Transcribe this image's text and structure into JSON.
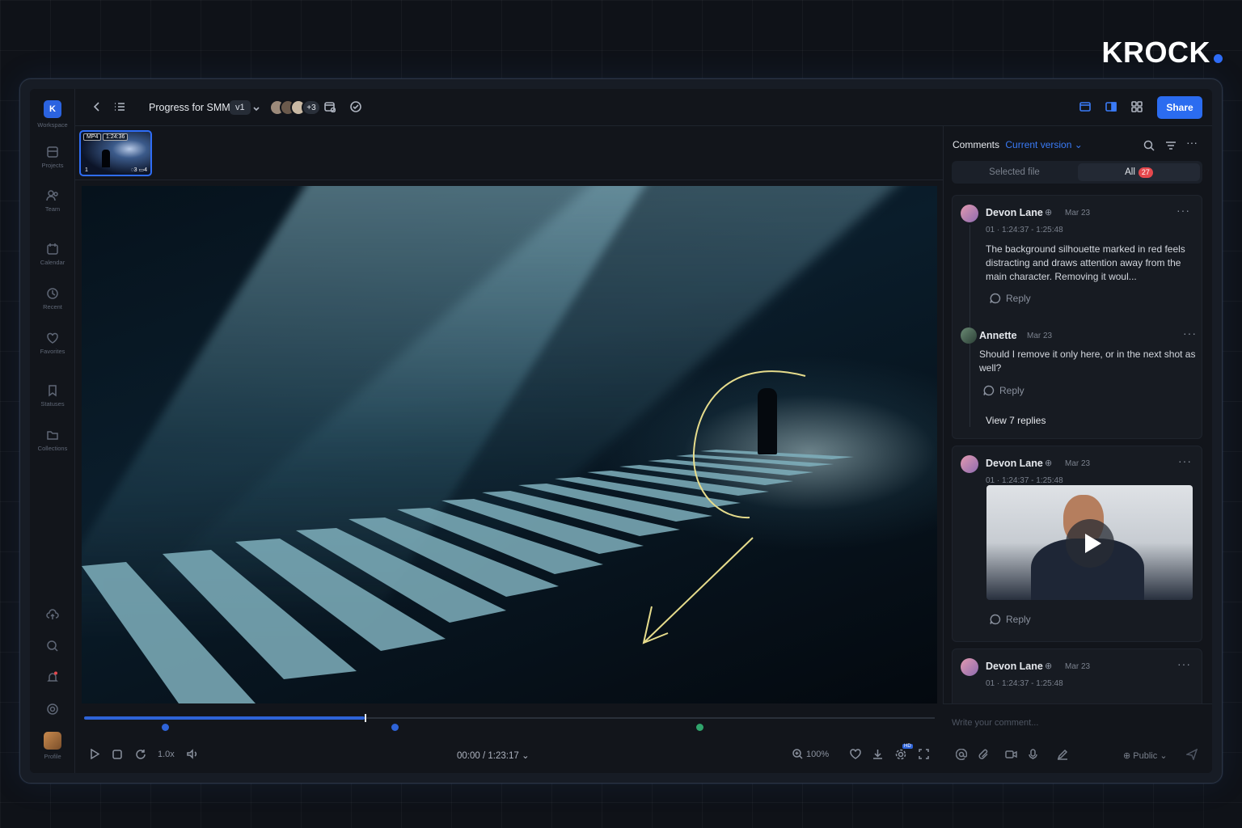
{
  "brand": {
    "name": "KROCK"
  },
  "sidebar": {
    "items": [
      {
        "label": "Workspace",
        "icon": "workspace-icon"
      },
      {
        "label": "Projects",
        "icon": "projects-icon"
      },
      {
        "label": "Team",
        "icon": "team-icon"
      },
      {
        "label": "Calendar",
        "icon": "calendar-icon"
      },
      {
        "label": "Recent",
        "icon": "clock-icon"
      },
      {
        "label": "Favorites",
        "icon": "heart-icon"
      },
      {
        "label": "Statuses",
        "icon": "bookmark-icon"
      },
      {
        "label": "Collections",
        "icon": "folder-icon"
      },
      {
        "label": "Profile",
        "icon": "avatar"
      }
    ],
    "workspace_initial": "K"
  },
  "header": {
    "title": "Progress for SMM",
    "version": "v1",
    "extra_collaborators": "+3",
    "share_label": "Share"
  },
  "thumbnail": {
    "format": "MP4",
    "duration": "1:24:36",
    "index": "1",
    "comments": "3",
    "annotations": "4"
  },
  "player": {
    "speed": "1.0x",
    "time": "00:00 / 1:23:17",
    "zoom": "100%",
    "progress": 0.33,
    "hd_badge": "HD"
  },
  "panel": {
    "title": "Comments",
    "version_filter": "Current version",
    "tabs": {
      "selected": "Selected file",
      "all": "All",
      "all_count": "27"
    },
    "comments": [
      {
        "author": "Devon Lane",
        "date": "Mar 23",
        "timecode": "01 · 1:24:37 - 1:25:48",
        "text": "The background silhouette marked in red feels distracting and draws attention away from the main character. Removing it woul...",
        "reply_label": "Reply"
      },
      {
        "author": "Annette",
        "date": "Mar 23",
        "text": "Should I remove it only here, or in the next shot as well?",
        "reply_label": "Reply",
        "more_replies": "View 7 replies"
      },
      {
        "author": "Devon Lane",
        "date": "Mar 23",
        "timecode": "01 · 1:24:37 - 1:25:48",
        "reply_label": "Reply"
      },
      {
        "author": "Devon Lane",
        "date": "Mar 23",
        "timecode": "01 · 1:24:37 - 1:25:48"
      }
    ],
    "input_placeholder": "Write your comment...",
    "visibility": "Public"
  },
  "colors": {
    "accent": "#2b6cf0",
    "annotation": "#e6dc8c",
    "badge": "#e5484d"
  }
}
